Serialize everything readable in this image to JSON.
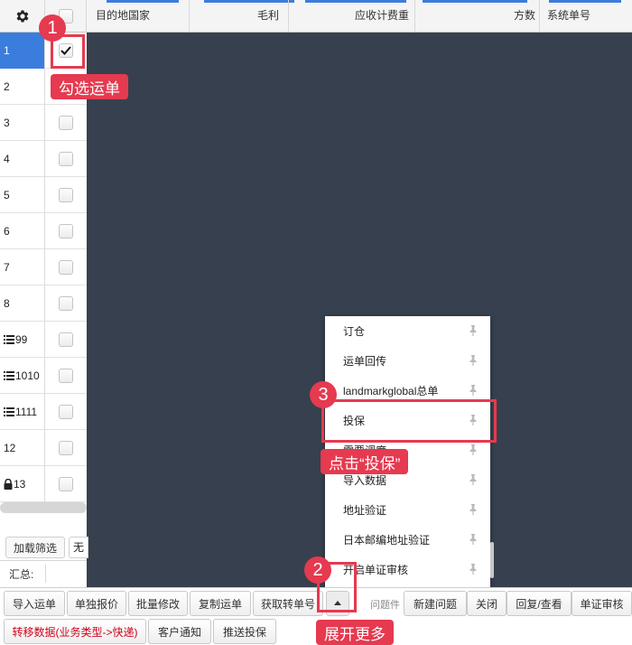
{
  "header": {
    "columns": [
      "目的地国家",
      "毛利",
      "应收计费重",
      "方数",
      "系统单号"
    ]
  },
  "rows": [
    {
      "num": "1",
      "checked": true,
      "icon": ""
    },
    {
      "num": "2",
      "checked": false,
      "icon": ""
    },
    {
      "num": "3",
      "checked": false,
      "icon": ""
    },
    {
      "num": "4",
      "checked": false,
      "icon": ""
    },
    {
      "num": "5",
      "checked": false,
      "icon": ""
    },
    {
      "num": "6",
      "checked": false,
      "icon": ""
    },
    {
      "num": "7",
      "checked": false,
      "icon": ""
    },
    {
      "num": "8",
      "checked": false,
      "icon": ""
    },
    {
      "num": "99",
      "checked": false,
      "icon": "list-icon"
    },
    {
      "num": "1010",
      "checked": false,
      "icon": "list-icon"
    },
    {
      "num": "1111",
      "checked": false,
      "icon": "list-icon"
    },
    {
      "num": "12",
      "checked": false,
      "icon": ""
    },
    {
      "num": "13",
      "checked": false,
      "icon": "lock-icon"
    }
  ],
  "filter": {
    "load_label": "加载筛选",
    "extra_label": "无"
  },
  "summary": {
    "label": "汇总:"
  },
  "menu": {
    "items": [
      "订仓",
      "运单回传",
      "landmarkglobal总单",
      "投保",
      "需要调度",
      "导入数据",
      "地址验证",
      "日本邮编地址验证",
      "开启单证审核"
    ]
  },
  "toolbar": {
    "row1": [
      "导入运单",
      "单独报价",
      "批量修改",
      "复制运单",
      "获取转单号"
    ],
    "tab_label": "问题件",
    "tab_buttons": [
      "新建问题",
      "关闭",
      "回复/查看",
      "单证审核"
    ],
    "row2": [
      "转移数据(业务类型->快递)",
      "客户通知",
      "推送投保"
    ]
  },
  "annotations": {
    "badge1": "1",
    "callout1": "勾选运单",
    "badge2": "2",
    "callout2": "展开更多",
    "badge3": "3",
    "callout3": "点击“投保”"
  },
  "colors": {
    "accent": "#3b7ddd",
    "annotation": "#e53a4f",
    "backdrop": "#37404e"
  }
}
